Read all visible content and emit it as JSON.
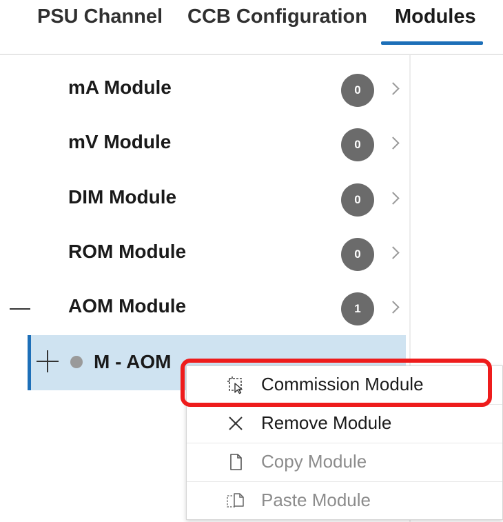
{
  "tabs": [
    {
      "label": "PSU Channel",
      "active": false
    },
    {
      "label": "CCB Configuration",
      "active": false
    },
    {
      "label": "Modules",
      "active": true
    }
  ],
  "accent_color": "#1d6fb8",
  "modules": [
    {
      "label": "mA Module",
      "count": "0",
      "expanded": false
    },
    {
      "label": "mV Module",
      "count": "0",
      "expanded": false
    },
    {
      "label": "DIM Module",
      "count": "0",
      "expanded": false
    },
    {
      "label": "ROM Module",
      "count": "0",
      "expanded": false
    },
    {
      "label": "AOM Module",
      "count": "1",
      "expanded": true
    }
  ],
  "child_item": {
    "label": "M - AOM",
    "status_color": "#9a9a9a",
    "selected": true
  },
  "context_menu": {
    "items": [
      {
        "label": "Commission Module",
        "icon": "commission-icon",
        "enabled": true,
        "highlighted": true
      },
      {
        "label": "Remove Module",
        "icon": "close-icon",
        "enabled": true
      },
      {
        "label": "Copy Module",
        "icon": "document-icon",
        "enabled": false
      },
      {
        "label": "Paste Module",
        "icon": "paste-icon",
        "enabled": false
      }
    ]
  },
  "highlight_color": "#ee1c1c"
}
